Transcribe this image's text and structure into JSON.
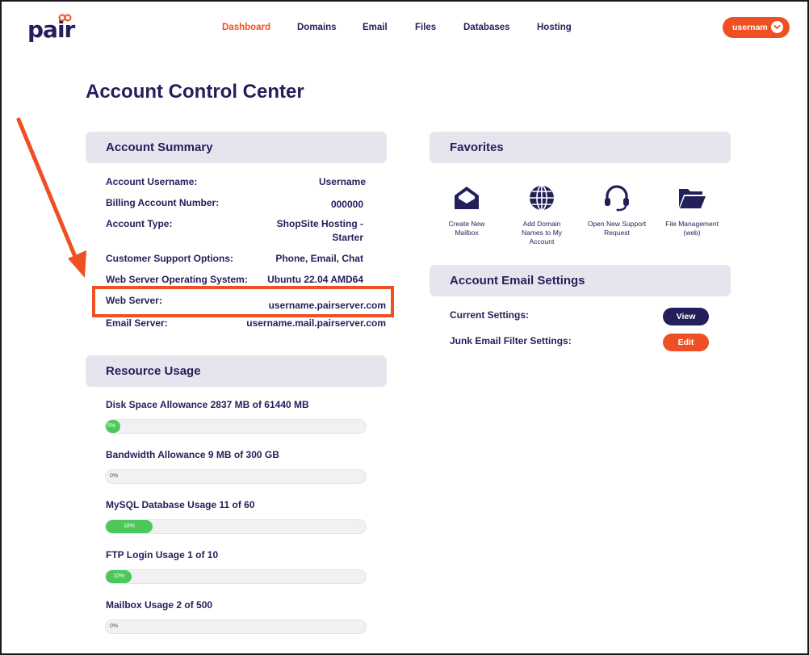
{
  "header": {
    "logo_text": "pair",
    "nav": [
      "Dashboard",
      "Domains",
      "Email",
      "Files",
      "Databases",
      "Hosting"
    ],
    "active_nav": "Dashboard",
    "user_button": "usernam"
  },
  "page_title": "Account Control Center",
  "account_summary": {
    "title": "Account Summary",
    "rows": [
      {
        "label": "Account Username:",
        "value": "Username"
      },
      {
        "label": "Billing Account Number:",
        "value": "000000"
      },
      {
        "label": "Account Type:",
        "value": "ShopSite Hosting -",
        "value2": "Starter"
      },
      {
        "label": "Customer Support Options:",
        "value": "Phone, Email, Chat"
      },
      {
        "label": "Web Server Operating System:",
        "value": "Ubuntu 22.04 AMD64"
      },
      {
        "label": "Web Server:",
        "value": "username.pairserver.com"
      },
      {
        "label": "Email Server:",
        "value": "username.mail.pairserver.com"
      }
    ]
  },
  "resource_usage": {
    "title": "Resource Usage",
    "items": [
      {
        "label": "Disk Space Allowance 2837 MB of 61440 MB",
        "percent_text": "5%",
        "percent": 5
      },
      {
        "label": "Bandwidth Allowance 9 MB of 300 GB",
        "percent_text": "0%",
        "percent": 0
      },
      {
        "label": "MySQL Database Usage 11 of 60",
        "percent_text": "18%",
        "percent": 18
      },
      {
        "label": "FTP Login Usage 1 of 10",
        "percent_text": "10%",
        "percent": 10
      },
      {
        "label": "Mailbox Usage 2 of 500",
        "percent_text": "0%",
        "percent": 0
      }
    ]
  },
  "favorites": {
    "title": "Favorites",
    "items": [
      {
        "icon": "mailbox-icon",
        "label_lines": [
          "Create New",
          "Mailbox"
        ]
      },
      {
        "icon": "globe-icon",
        "label_lines": [
          "Add Domain",
          "Names to My",
          "Account"
        ]
      },
      {
        "icon": "headset-icon",
        "label_lines": [
          "Open New Support",
          "Request"
        ]
      },
      {
        "icon": "folder-icon",
        "label_lines": [
          "File Management",
          "(web)"
        ]
      }
    ]
  },
  "email_settings": {
    "title": "Account Email Settings",
    "current_label": "Current Settings:",
    "current_button": "View",
    "junk_label": "Junk Email Filter Settings:",
    "junk_button": "Edit"
  },
  "colors": {
    "brand_navy": "#231f5a",
    "accent_orange": "#ef5023",
    "panel_gray": "#e6e5ee",
    "usage_green": "#4cc75a"
  }
}
